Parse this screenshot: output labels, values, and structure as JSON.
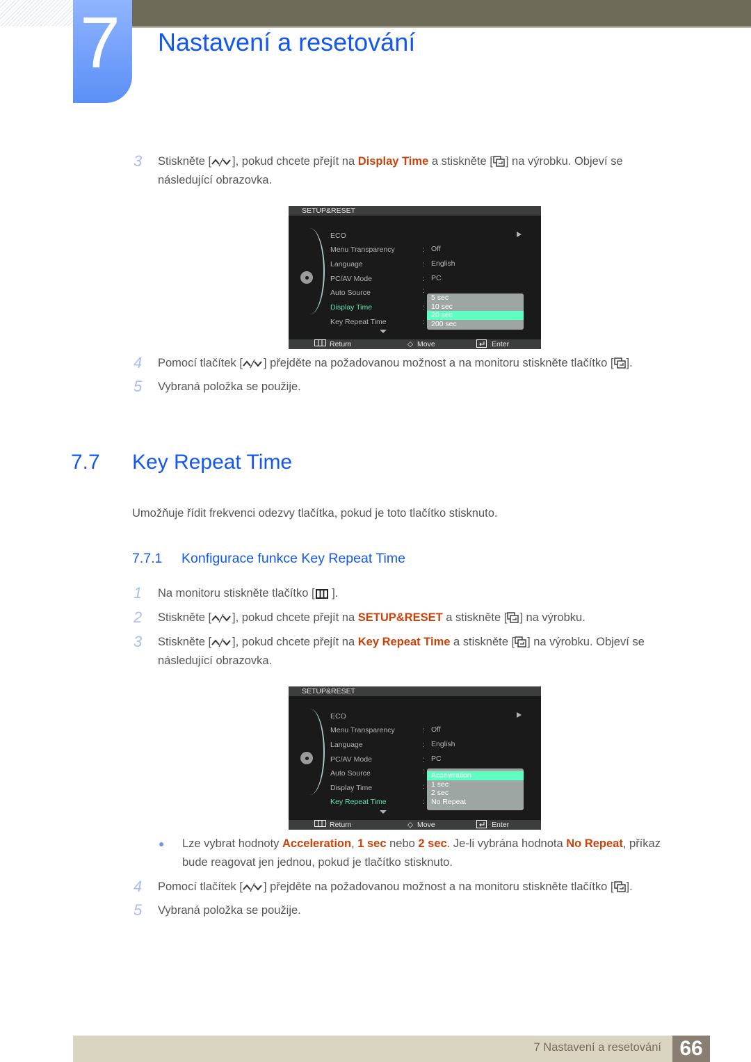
{
  "header": {
    "chapter_number": "7",
    "chapter_title": "Nastavení a resetování"
  },
  "section_a": {
    "steps": [
      {
        "num": "3",
        "parts": [
          "Stiskněte [",
          "], pokud chcete přejít na ",
          "Display Time",
          " a stiskněte [",
          "] na výrobku. Objeví se"
        ],
        "line2": "následující obrazovka."
      },
      {
        "num": "4",
        "parts": [
          "Pomocí tlačítek [",
          "] přejděte na požadovanou možnost a na monitoru stiskněte tlačítko [",
          "]."
        ]
      },
      {
        "num": "5",
        "text": "Vybraná položka se použije."
      }
    ]
  },
  "osd1": {
    "title": "SETUP&RESET",
    "items": [
      {
        "label": "ECO",
        "value": ""
      },
      {
        "label": "Menu Transparency",
        "value": "Off"
      },
      {
        "label": "Language",
        "value": "English"
      },
      {
        "label": "PC/AV Mode",
        "value": "PC"
      },
      {
        "label": "Auto Source",
        "value": ""
      },
      {
        "label": "Display Time",
        "value": ""
      },
      {
        "label": "Key Repeat Time",
        "value": ""
      }
    ],
    "selected": "Display Time",
    "options": [
      "5 sec",
      "10 sec",
      "20 sec",
      "200 sec"
    ],
    "active_option": "20 sec",
    "footer": {
      "return": "Return",
      "move": "Move",
      "enter": "Enter"
    }
  },
  "section": {
    "number": "7.7",
    "title": "Key Repeat Time",
    "description": "Umožňuje řídit frekvenci odezvy tlačítka, pokud je toto tlačítko stisknuto.",
    "sub_number": "7.7.1",
    "sub_title": "Konfigurace funkce Key Repeat Time"
  },
  "section_b": {
    "steps": [
      {
        "num": "1",
        "parts": [
          "Na monitoru stiskněte tlačítko [",
          " ]."
        ]
      },
      {
        "num": "2",
        "parts": [
          "Stiskněte [",
          "], pokud chcete přejít na ",
          "SETUP&RESET",
          " a stiskněte [",
          "] na výrobku."
        ]
      },
      {
        "num": "3",
        "parts": [
          "Stiskněte [",
          "], pokud chcete přejít na ",
          "Key Repeat Time",
          " a stiskněte [",
          "] na výrobku. Objeví se"
        ],
        "line2": "následující obrazovka."
      },
      {
        "num": "4",
        "parts": [
          "Pomocí tlačítek [",
          "] přejděte na požadovanou možnost a na monitoru stiskněte tlačítko [",
          "]."
        ]
      },
      {
        "num": "5",
        "text": "Vybraná položka se použije."
      }
    ],
    "note": {
      "parts": [
        "Lze vybrat hodnoty ",
        "Acceleration",
        ", ",
        "1 sec",
        " nebo ",
        "2 sec",
        ". Je-li vybrána hodnota ",
        "No Repeat",
        ", příkaz"
      ],
      "line2": "bude reagovat jen jednou, pokud je tlačítko stisknuto."
    }
  },
  "osd2": {
    "title": "SETUP&RESET",
    "items": [
      {
        "label": "ECO",
        "value": ""
      },
      {
        "label": "Menu Transparency",
        "value": "Off"
      },
      {
        "label": "Language",
        "value": "English"
      },
      {
        "label": "PC/AV Mode",
        "value": "PC"
      },
      {
        "label": "Auto Source",
        "value": ""
      },
      {
        "label": "Display Time",
        "value": ""
      },
      {
        "label": "Key Repeat Time",
        "value": ""
      }
    ],
    "selected": "Key Repeat Time",
    "options": [
      "Acceleration",
      "1 sec",
      "2 sec",
      "No Repeat"
    ],
    "active_option": "Acceleration",
    "footer": {
      "return": "Return",
      "move": "Move",
      "enter": "Enter"
    }
  },
  "page_footer": {
    "chapter_label": "7 Nastavení a resetování",
    "page_number": "66"
  },
  "icons": {
    "updown": "up-down-arrows-icon",
    "enter": "enter-source-icon",
    "menu": "menu-icon"
  },
  "colors": {
    "accent_blue": "#1257ef",
    "highlight": "#c8420a",
    "osd_selected": "#5ee0a8",
    "osd_active_option": "#5effc0"
  }
}
